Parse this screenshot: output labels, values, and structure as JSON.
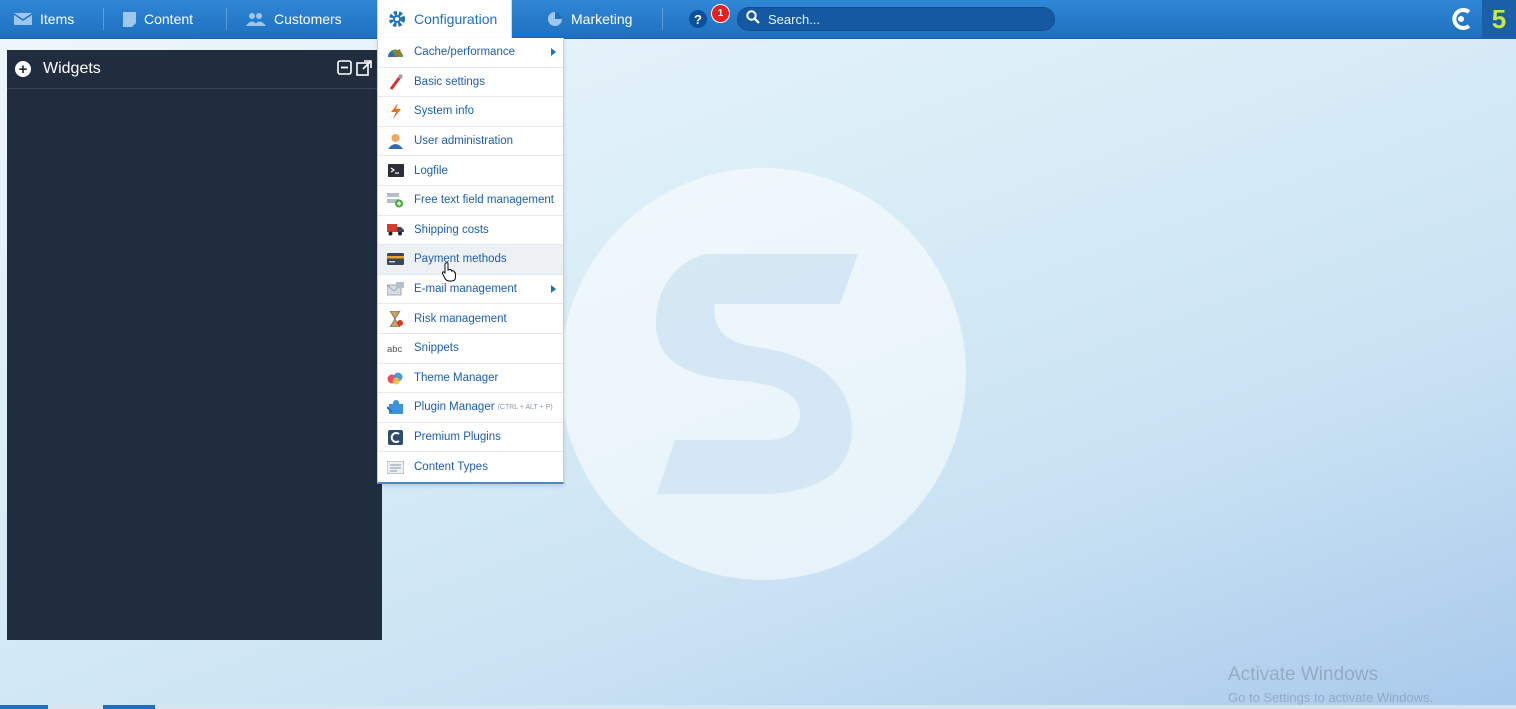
{
  "nav": {
    "items": [
      {
        "label": "Items",
        "icon": "inbox-icon"
      },
      {
        "label": "Content",
        "icon": "document-icon"
      },
      {
        "label": "Customers",
        "icon": "users-icon"
      },
      {
        "label": "Configuration",
        "icon": "gear-icon"
      },
      {
        "label": "Marketing",
        "icon": "pie-chart-icon"
      }
    ],
    "help_label": "?",
    "notification_count": "1",
    "search_placeholder": "Search...",
    "brand_mark": "5"
  },
  "widgets": {
    "title": "Widgets",
    "add_label": "+"
  },
  "config_menu": {
    "items": [
      {
        "label": "Cache/performance",
        "icon": "speedometer-icon",
        "submenu": true
      },
      {
        "label": "Basic settings",
        "icon": "wrench-icon"
      },
      {
        "label": "System info",
        "icon": "lightning-icon"
      },
      {
        "label": "User administration",
        "icon": "user-icon"
      },
      {
        "label": "Logfile",
        "icon": "terminal-icon"
      },
      {
        "label": "Free text field management",
        "icon": "form-add-icon"
      },
      {
        "label": "Shipping costs",
        "icon": "truck-icon"
      },
      {
        "label": "Payment methods",
        "icon": "credit-card-icon",
        "hover": true
      },
      {
        "label": "E-mail management",
        "icon": "email-icon",
        "submenu": true
      },
      {
        "label": "Risk management",
        "icon": "hourglass-icon"
      },
      {
        "label": "Snippets",
        "icon": "abc-icon"
      },
      {
        "label": "Theme Manager",
        "icon": "theme-icon"
      },
      {
        "label": "Plugin Manager",
        "icon": "puzzle-icon",
        "shortcut": "(CTRL + ALT + P)"
      },
      {
        "label": "Premium Plugins",
        "icon": "premium-logo-icon"
      },
      {
        "label": "Content Types",
        "icon": "content-types-icon"
      }
    ]
  },
  "os_watermark": {
    "line1": "Activate Windows",
    "line2": "Go to Settings to activate Windows."
  },
  "colors": {
    "topbar": "#1f6fc0",
    "panel": "#202d3f",
    "menu_text": "#1d5fae",
    "notification": "#e42020",
    "brand_accent": "#c7e84a"
  }
}
